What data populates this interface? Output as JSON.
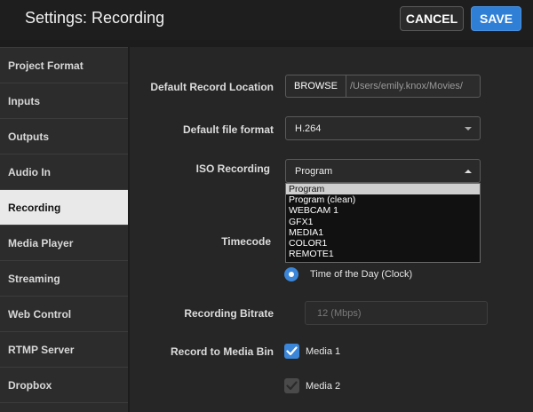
{
  "header": {
    "title": "Settings: Recording",
    "cancel_label": "CANCEL",
    "save_label": "SAVE"
  },
  "sidebar": {
    "items": [
      {
        "label": "Project Format"
      },
      {
        "label": "Inputs"
      },
      {
        "label": "Outputs"
      },
      {
        "label": "Audio In"
      },
      {
        "label": "Recording",
        "active": true
      },
      {
        "label": "Media Player"
      },
      {
        "label": "Streaming"
      },
      {
        "label": "Web Control"
      },
      {
        "label": "RTMP Server"
      },
      {
        "label": "Dropbox"
      }
    ]
  },
  "form": {
    "record_location": {
      "label": "Default Record Location",
      "browse_label": "BROWSE",
      "path": "/Users/emily.knox/Movies/"
    },
    "file_format": {
      "label": "Default file format",
      "value": "H.264"
    },
    "iso_recording": {
      "label": "ISO Recording",
      "value": "Program",
      "options": [
        "Program",
        "Program (clean)",
        "WEBCAM 1",
        "GFX1",
        "MEDIA1",
        "COLOR1",
        "REMOTE1"
      ],
      "selected_index": 0
    },
    "timecode": {
      "label": "Timecode",
      "option_label": "Time of the Day (Clock)",
      "selected": true
    },
    "bitrate": {
      "label": "Recording Bitrate",
      "placeholder": "12 (Mbps)"
    },
    "media_bin": {
      "label": "Record to Media Bin",
      "items": [
        {
          "label": "Media 1",
          "checked": true,
          "enabled": true
        },
        {
          "label": "Media 2",
          "checked": true,
          "enabled": false
        }
      ]
    }
  },
  "colors": {
    "accent": "#2f7fd6",
    "active_nav_bg": "#e9e9e9",
    "panel_bg": "#262626",
    "sidebar_bg": "#2c2c2c"
  }
}
